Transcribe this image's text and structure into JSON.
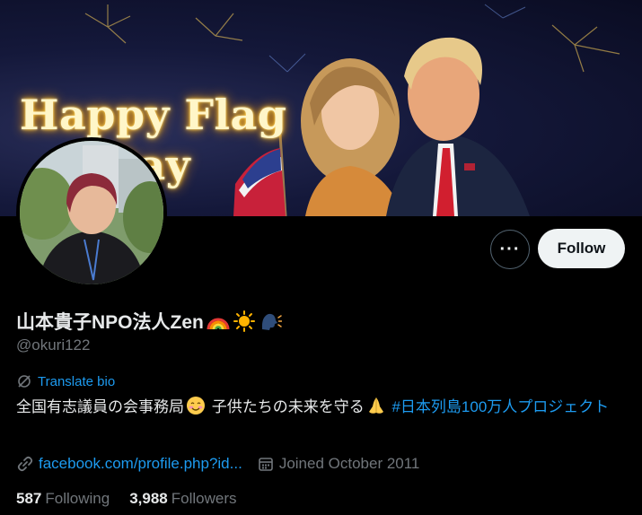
{
  "banner": {
    "text_line1": "Happy Flag",
    "text_line2": "Day"
  },
  "profile": {
    "display_name": "山本貴子NPO法人Zen",
    "name_emojis": [
      "rainbow",
      "sun",
      "speaking-head"
    ],
    "handle": "@okuri122",
    "more_label": "···",
    "follow_label": "Follow",
    "translate_label": "Translate bio",
    "bio_part1": "全国有志議員の会事務局",
    "bio_part2": " 子供たちの未来を守る",
    "bio_hashtag": "#日本列島100万人プロジェクト",
    "bio_emojis": [
      "smiling-face",
      "folded-hands"
    ],
    "link_text": "facebook.com/profile.php?id...",
    "joined_text": "Joined October 2011",
    "following_count": "587",
    "following_label": "Following",
    "followers_count": "3,988",
    "followers_label": "Followers"
  },
  "colors": {
    "background": "#000000",
    "accent": "#1d9bf0",
    "secondary_text": "#71767b",
    "primary_text": "#e7e9ea",
    "follow_button_bg": "#eff3f4"
  }
}
